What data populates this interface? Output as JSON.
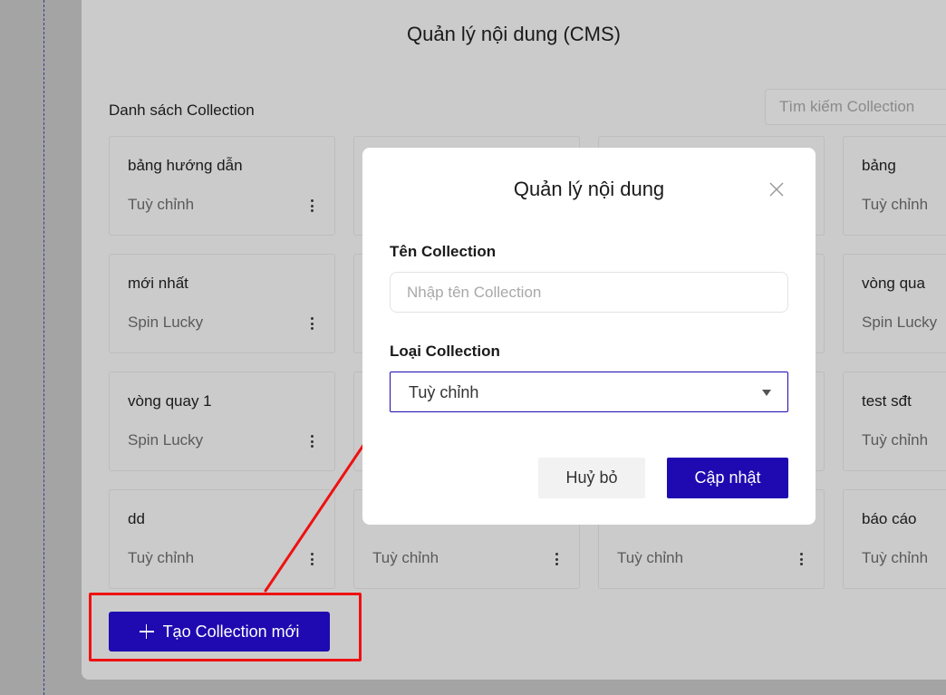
{
  "page": {
    "title": "Quản lý nội dung (CMS)",
    "list_title": "Danh sách Collection",
    "search_placeholder": "Tìm kiếm Collection",
    "create_label": "Tạo Collection mới"
  },
  "cards": [
    {
      "name": "bảng hướng dẫn",
      "type": "Tuỳ chỉnh"
    },
    {
      "name": "",
      "type": ""
    },
    {
      "name": "",
      "type": ""
    },
    {
      "name": "bảng",
      "type": "Tuỳ chỉnh"
    },
    {
      "name": "mới nhất",
      "type": "Spin Lucky"
    },
    {
      "name": "",
      "type": ""
    },
    {
      "name": "",
      "type": ""
    },
    {
      "name": "vòng qua",
      "type": "Spin Lucky"
    },
    {
      "name": "vòng quay 1",
      "type": "Spin Lucky"
    },
    {
      "name": "",
      "type": ""
    },
    {
      "name": "",
      "type": ""
    },
    {
      "name": "test sđt",
      "type": "Tuỳ chỉnh"
    },
    {
      "name": "dd",
      "type": "Tuỳ chỉnh"
    },
    {
      "name": "",
      "type": "Tuỳ chỉnh"
    },
    {
      "name": "",
      "type": "Tuỳ chỉnh"
    },
    {
      "name": "báo cáo",
      "type": "Tuỳ chỉnh"
    }
  ],
  "modal": {
    "title": "Quản lý nội dung",
    "name_label": "Tên Collection",
    "name_placeholder": "Nhập tên Collection",
    "type_label": "Loại Collection",
    "type_value": "Tuỳ chỉnh",
    "cancel_label": "Huỷ bỏ",
    "update_label": "Cập nhật"
  },
  "colors": {
    "primary": "#1e0ab0",
    "annotation": "#ee1111",
    "overlay": "#cbcbcb"
  },
  "icons": [
    "plus-icon",
    "close-icon",
    "caret-down-icon",
    "more-vertical-icon"
  ]
}
